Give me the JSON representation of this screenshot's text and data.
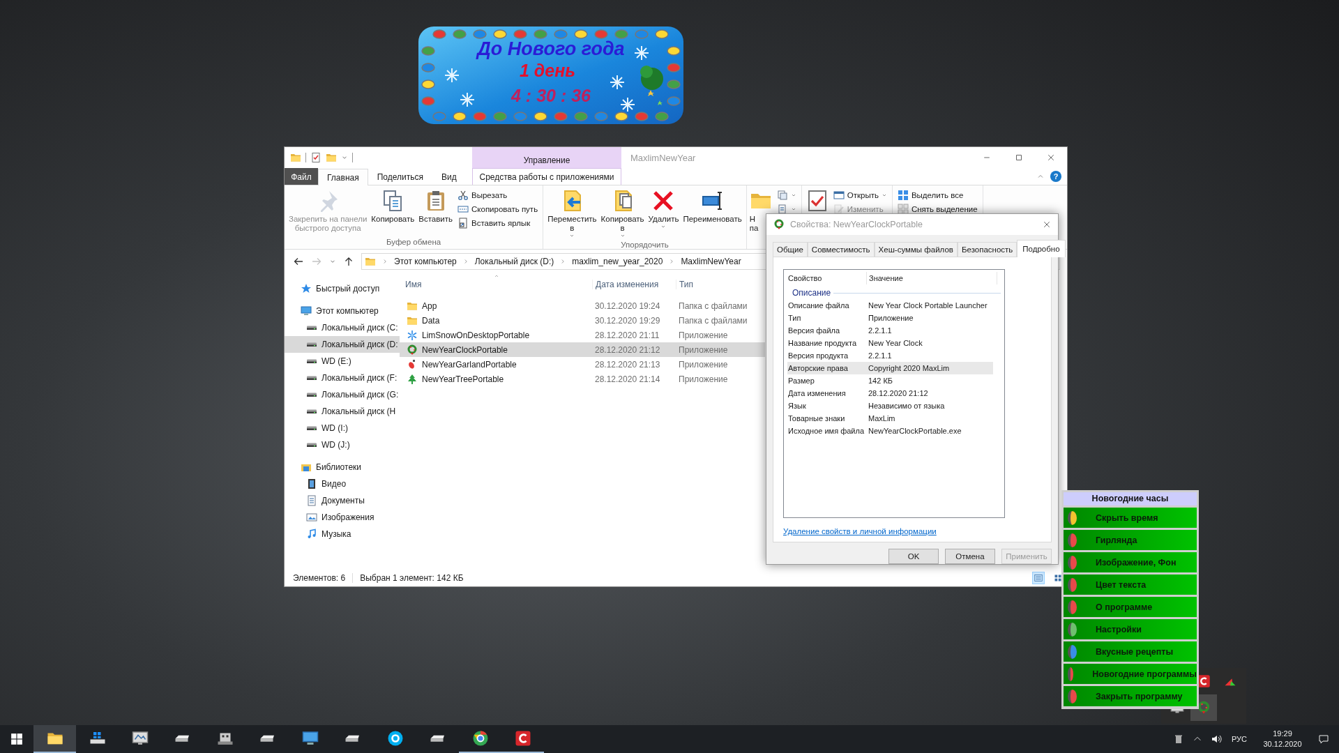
{
  "countdown": {
    "title": "До Нового года",
    "days": "1 день",
    "time": "4 : 30 : 36"
  },
  "explorer": {
    "title": "MaxlimNewYear",
    "context_tab_header": "Управление",
    "tabs": [
      {
        "label": "Файл",
        "kind": "file",
        "selected": false
      },
      {
        "label": "Главная",
        "kind": "tab",
        "selected": true
      },
      {
        "label": "Поделиться",
        "kind": "tab",
        "selected": false
      },
      {
        "label": "Вид",
        "kind": "tab",
        "selected": false
      },
      {
        "label": "Средства работы с приложениями",
        "kind": "context",
        "selected": false
      }
    ],
    "help": "?",
    "ribbon": {
      "groups": [
        {
          "label": "Буфер обмена",
          "large": [
            {
              "lines": [
                "Закрепить на панели",
                "быстрого доступа"
              ],
              "disabled": true
            },
            {
              "lines": [
                "Копировать"
              ],
              "disabled": false
            },
            {
              "lines": [
                "Вставить"
              ],
              "disabled": false
            }
          ],
          "small": [
            {
              "label": "Вырезать",
              "disabled": false
            },
            {
              "label": "Скопировать путь",
              "disabled": false
            },
            {
              "label": "Вставить ярлык",
              "disabled": false
            }
          ]
        },
        {
          "label": "Упорядочить",
          "large": [
            {
              "lines": [
                "Переместить",
                "в"
              ],
              "disabled": false,
              "dropdown": true
            },
            {
              "lines": [
                "Копировать",
                "в"
              ],
              "disabled": false,
              "dropdown": true
            },
            {
              "lines": [
                "Удалить"
              ],
              "disabled": false,
              "dropdown": true
            },
            {
              "lines": [
                "Переименовать"
              ],
              "disabled": false
            }
          ]
        },
        {
          "large": [
            {
              "lines": [
                "Н",
                "па"
              ],
              "disabled": false
            }
          ],
          "small": [
            {
              "disabled": false,
              "dropdown": true
            },
            {
              "disabled": false,
              "dropdown": true
            }
          ]
        },
        {
          "large": [
            {
              "disabled": false
            }
          ],
          "small": [
            {
              "label": "Открыть",
              "disabled": false,
              "dropdown": true
            },
            {
              "label": "Изменить",
              "disabled": true
            }
          ]
        },
        {
          "small": [
            {
              "label": "Выделить все",
              "disabled": false
            },
            {
              "label": "Снять выделение",
              "disabled": false
            }
          ]
        }
      ]
    },
    "address": {
      "path": [
        "Этот компьютер",
        "Локальный диск (D:)",
        "maxlim_new_year_2020",
        "MaxlimNewYear"
      ]
    },
    "navigation": [
      {
        "label": "Быстрый доступ",
        "kind": "quick",
        "selected": false
      },
      {
        "label": "Этот компьютер",
        "kind": "computer",
        "selected": false,
        "children": [
          {
            "label": "Локальный диск (C:",
            "kind": "drive",
            "selected": false
          },
          {
            "label": "Локальный диск (D:",
            "kind": "drive",
            "selected": true
          },
          {
            "label": "WD (E:)",
            "kind": "drive",
            "selected": false
          },
          {
            "label": "Локальный диск (F:",
            "kind": "drive",
            "selected": false
          },
          {
            "label": "Локальный диск (G:",
            "kind": "drive",
            "selected": false
          },
          {
            "label": "Локальный диск (H",
            "kind": "drive",
            "selected": false
          },
          {
            "label": "WD (I:)",
            "kind": "drive",
            "selected": false
          },
          {
            "label": "WD (J:)",
            "kind": "drive",
            "selected": false
          }
        ]
      },
      {
        "label": "Библиотеки",
        "kind": "library",
        "selected": false,
        "children": [
          {
            "label": "Видео",
            "kind": "video",
            "selected": false
          },
          {
            "label": "Документы",
            "kind": "documents",
            "selected": false
          },
          {
            "label": "Изображения",
            "kind": "pictures",
            "selected": false
          },
          {
            "label": "Музыка",
            "kind": "music",
            "selected": false
          }
        ]
      }
    ],
    "file_list": {
      "columns": [
        "Имя",
        "Дата изменения",
        "Тип"
      ],
      "rows": [
        {
          "name": "App",
          "date": "30.12.2020 19:24",
          "type": "Папка с файлами",
          "kind": "folder",
          "selected": false
        },
        {
          "name": "Data",
          "date": "30.12.2020 19:29",
          "type": "Папка с файлами",
          "kind": "folder",
          "selected": false
        },
        {
          "name": "LimSnowOnDesktopPortable",
          "date": "28.12.2020 21:11",
          "type": "Приложение",
          "kind": "application",
          "selected": false
        },
        {
          "name": "NewYearClockPortable",
          "date": "28.12.2020 21:12",
          "type": "Приложение",
          "kind": "application",
          "selected": true
        },
        {
          "name": "NewYearGarlandPortable",
          "date": "28.12.2020 21:13",
          "type": "Приложение",
          "kind": "application",
          "selected": false
        },
        {
          "name": "NewYearTreePortable",
          "date": "28.12.2020 21:14",
          "type": "Приложение",
          "kind": "application",
          "selected": false
        }
      ]
    },
    "status_bar": {
      "items_count": "Элементов: 6",
      "selection": "Выбран 1 элемент: 142 КБ",
      "views": [
        {
          "selected": true
        },
        {
          "selected": false
        }
      ]
    }
  },
  "properties_dialog": {
    "title": "Свойства: NewYearClockPortable",
    "tabs": [
      {
        "label": "Общие",
        "selected": false
      },
      {
        "label": "Совместимость",
        "selected": false
      },
      {
        "label": "Хеш-суммы файлов",
        "selected": false
      },
      {
        "label": "Безопасность",
        "selected": false
      },
      {
        "label": "Подробно",
        "selected": true
      }
    ],
    "columns": [
      "Свойство",
      "Значение"
    ],
    "section": "Описание",
    "rows": [
      {
        "property": "Описание файла",
        "value": "New Year Clock Portable Launcher",
        "selected": false
      },
      {
        "property": "Тип",
        "value": "Приложение",
        "selected": false
      },
      {
        "property": "Версия файла",
        "value": "2.2.1.1",
        "selected": false
      },
      {
        "property": "Название продукта",
        "value": "New Year Clock",
        "selected": false
      },
      {
        "property": "Версия продукта",
        "value": "2.2.1.1",
        "selected": false
      },
      {
        "property": "Авторские права",
        "value": "Copyright 2020 MaxLim",
        "selected": true
      },
      {
        "property": "Размер",
        "value": "142 КБ",
        "selected": false
      },
      {
        "property": "Дата изменения",
        "value": "28.12.2020 21:12",
        "selected": false
      },
      {
        "property": "Язык",
        "value": "Независимо от языка",
        "selected": false
      },
      {
        "property": "Товарные знаки",
        "value": "MaxLim",
        "selected": false
      },
      {
        "property": "Исходное имя файла",
        "value": "NewYearClockPortable.exe",
        "selected": false
      }
    ],
    "link": "Удаление свойств и личной информации",
    "buttons": [
      {
        "label": "OK",
        "disabled": false
      },
      {
        "label": "Отмена",
        "disabled": false
      },
      {
        "label": "Применить",
        "disabled": true
      }
    ]
  },
  "tray_menu": {
    "title": "Новогодние часы",
    "items": [
      {
        "label": "Скрыть время",
        "color": "#f2c230"
      },
      {
        "label": "Гирлянда",
        "color": "#e84a4a"
      },
      {
        "label": "Изображение, Фон",
        "color": "#e84a4a"
      },
      {
        "label": "Цвет текста",
        "color": "#e84a4a"
      },
      {
        "label": "О программе",
        "color": "#e84a4a"
      },
      {
        "label": "Настройки",
        "color": "#6fbf6f"
      },
      {
        "label": "Вкусные рецепты",
        "color": "#3a8ee6"
      },
      {
        "label": "Новогодние программы",
        "color": "#e84a4a"
      },
      {
        "label": "Закрыть программу",
        "color": "#e84a4a"
      }
    ]
  },
  "taskbar": {
    "apps": [
      {
        "running": true,
        "selected": true
      },
      {
        "running": false,
        "selected": false
      },
      {
        "running": false,
        "selected": false
      },
      {
        "running": false,
        "selected": false
      },
      {
        "running": false,
        "selected": false
      },
      {
        "running": false,
        "selected": false
      },
      {
        "running": false,
        "selected": false
      },
      {
        "running": false,
        "selected": false
      },
      {
        "running": false,
        "selected": false
      },
      {
        "running": false,
        "selected": false
      },
      {
        "running": true,
        "selected": false
      },
      {
        "running": true,
        "selected": false
      }
    ],
    "language": "РУС",
    "time": "19:29",
    "date": "30.12.2020"
  }
}
